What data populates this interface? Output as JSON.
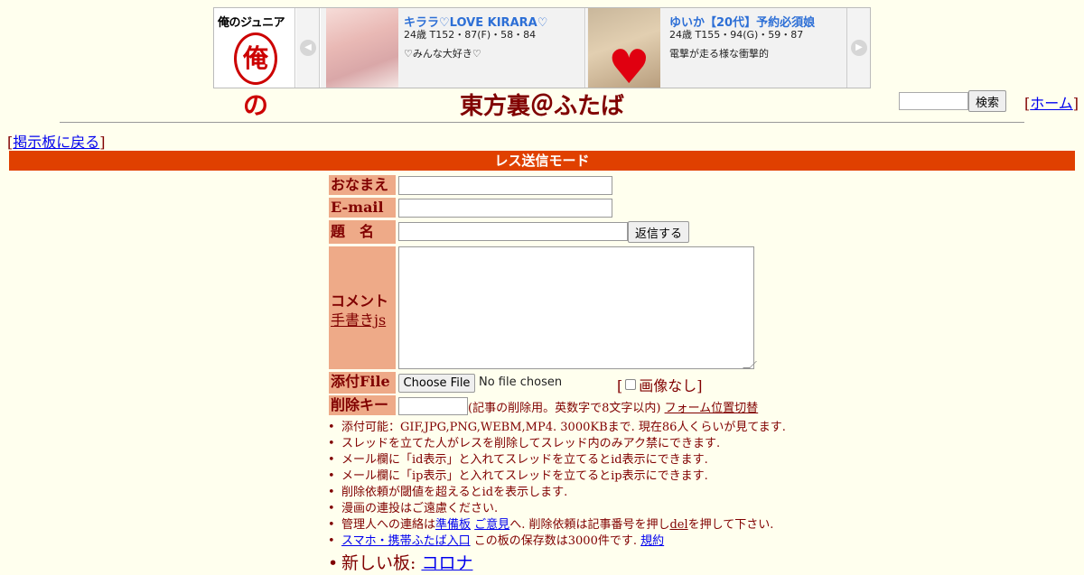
{
  "ad": {
    "logo_text": "俺のジュニア",
    "logo_mark": "俺の",
    "prev_arrow": "◀",
    "next_arrow": "▶",
    "cards": [
      {
        "name": "キララ♡LOVE KIRARA♡",
        "stats": "24歳 T152・87(F)・58・84",
        "desc": "♡みんな大好き♡"
      },
      {
        "name": "ゆいか【20代】予約必須娘",
        "stats": "24歳 T155・94(G)・59・87",
        "desc": "電撃が走る様な衝撃的"
      }
    ]
  },
  "header": {
    "title": "東方裏＠ふたば",
    "search_button": "検索",
    "home_link": "ホーム",
    "back_link": "掲示板に戻る"
  },
  "mode_bar": "レス送信モード",
  "form": {
    "name_label": "おなまえ",
    "email_label": "E-mail",
    "subject_label": "題　名",
    "reply_button": "返信する",
    "comment_label": "コメント",
    "tegaki_link": "手書きjs",
    "file_label": "添付File",
    "choose_file_button": "Choose File",
    "no_file_text": "No file chosen",
    "no_image_label": "画像なし",
    "delete_key_label": "削除キー",
    "delete_key_note": "(記事の削除用。英数字で8文字以内)",
    "form_position_link": "フォーム位置切替"
  },
  "notices": {
    "n1": "添付可能：GIF,JPG,PNG,WEBM,MP4. 3000KBまで. 現在86人くらいが見てます.",
    "n2": "スレッドを立てた人がレスを削除してスレッド内のみアク禁にできます.",
    "n3": "メール欄に「id表示」と入れてスレッドを立てるとid表示にできます.",
    "n4": "メール欄に「ip表示」と入れてスレッドを立てるとip表示にできます.",
    "n5": "削除依頼が閾値を超えるとidを表示します.",
    "n6": "漫画の連投はご遠慮ください.",
    "n7_pre": "管理人への連絡は",
    "n7_link1": "準備板",
    "n7_link2": "ご意見",
    "n7_mid": "へ. 削除依頼は記事番号を押し",
    "n7_del": "del",
    "n7_post": "を押して下さい.",
    "n8_link": "スマホ・携帯ふたば入口",
    "n8_text": "この板の保存数は3000件です.",
    "n8_rules": "規約",
    "n9_label": "新しい板:",
    "n9_link": "コロナ"
  }
}
